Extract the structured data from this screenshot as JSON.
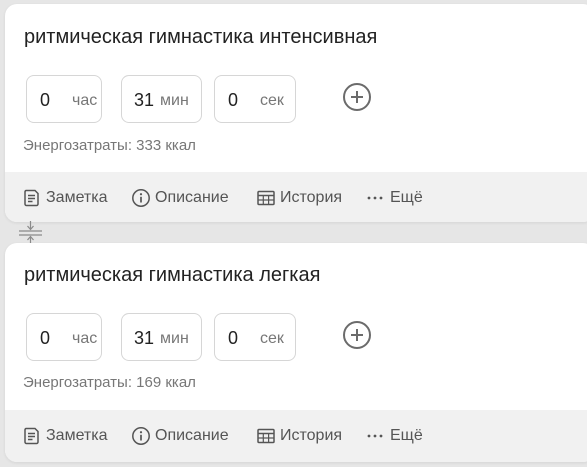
{
  "cards": [
    {
      "title": "ритмическая гимнастика интенсивная",
      "hours": {
        "value": "0",
        "unit": "час"
      },
      "minutes": {
        "value": "31",
        "unit": "мин"
      },
      "seconds": {
        "value": "0",
        "unit": "сек"
      },
      "energy": "Энергозатраты: 333 ккал",
      "actions": {
        "note": "Заметка",
        "description": "Описание",
        "history": "История",
        "more": "Ещё"
      }
    },
    {
      "title": "ритмическая гимнастика легкая",
      "hours": {
        "value": "0",
        "unit": "час"
      },
      "minutes": {
        "value": "31",
        "unit": "мин"
      },
      "seconds": {
        "value": "0",
        "unit": "сек"
      },
      "energy": "Энергозатраты: 169 ккал",
      "actions": {
        "note": "Заметка",
        "description": "Описание",
        "history": "История",
        "more": "Ещё"
      }
    }
  ],
  "icons": {
    "add": "plus-circle-icon",
    "note": "note-icon",
    "description": "info-circle-icon",
    "history": "table-icon",
    "more": "ellipsis-icon",
    "merge": "merge-divider-icon"
  },
  "colors": {
    "page_bg": "#e6e6e6",
    "card_bg": "#ffffff",
    "footer_bg": "#f1f1f1",
    "text_primary": "#222222",
    "text_secondary": "#777777",
    "icon_gray": "#6b6b6b"
  }
}
